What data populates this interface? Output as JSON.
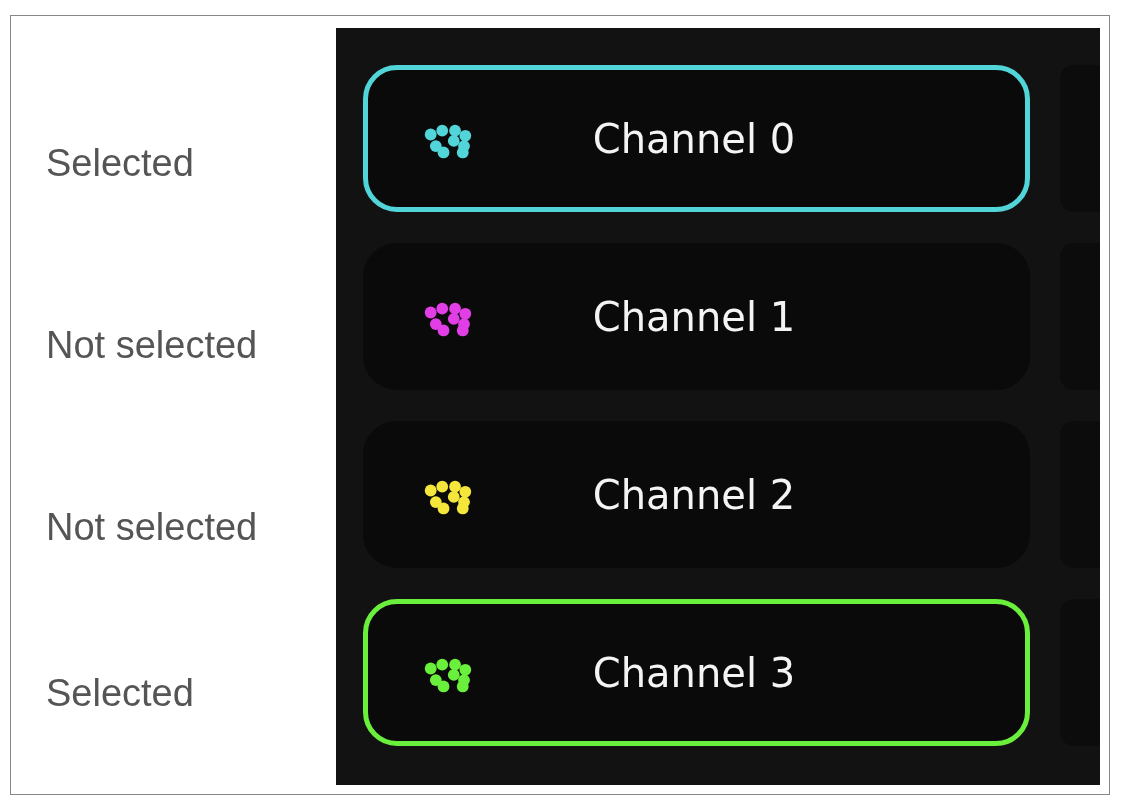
{
  "rows": [
    {
      "label": "Selected",
      "channel": {
        "name": "Channel 0",
        "color": "#52d5d9",
        "selected": true
      }
    },
    {
      "label": "Not selected",
      "channel": {
        "name": "Channel 1",
        "color": "#e23ee6",
        "selected": false
      }
    },
    {
      "label": "Not selected",
      "channel": {
        "name": "Channel 2",
        "color": "#f4e63a",
        "selected": false
      }
    },
    {
      "label": "Selected",
      "channel": {
        "name": "Channel 3",
        "color": "#6bef3d",
        "selected": true
      }
    }
  ]
}
